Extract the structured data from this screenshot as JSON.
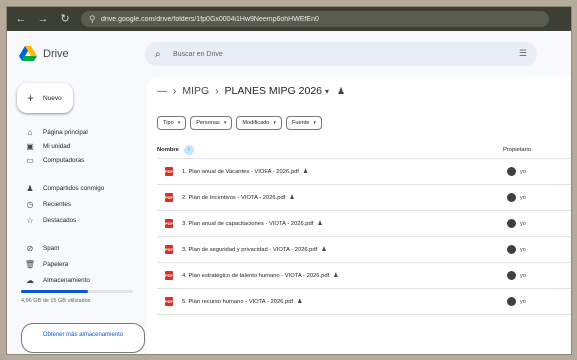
{
  "browser": {
    "url": "drive.google.com/drive/folders/1fp0Gx0004i1Hw9Neemp6ohHWEfEn0"
  },
  "app": {
    "name": "Drive",
    "search_placeholder": "Buscar en Drive"
  },
  "sidebar": {
    "new_label": "Nuevo",
    "items": [
      {
        "label": "Página principal",
        "icon": "home-icon"
      },
      {
        "label": "Mi unidad",
        "icon": "my-drive-icon"
      },
      {
        "label": "Computadoras",
        "icon": "computer-icon"
      },
      {
        "label": "Compartidos conmigo",
        "icon": "shared-icon"
      },
      {
        "label": "Recientes",
        "icon": "clock-icon"
      },
      {
        "label": "Destacados",
        "icon": "star-icon"
      },
      {
        "label": "Spam",
        "icon": "spam-icon"
      },
      {
        "label": "Papelera",
        "icon": "trash-icon"
      },
      {
        "label": "Almacenamiento",
        "icon": "cloud-icon"
      }
    ],
    "storage_used_fraction": 0.6,
    "storage_text": "4,96 GB de 15 GB utilizados",
    "get_more_label": "Obtener más almacenamiento"
  },
  "breadcrumb": {
    "parent": "MIPG",
    "current": "PLANES MIPG 2026"
  },
  "filters": [
    "Tipo",
    "Personas",
    "Modificado",
    "Fuente"
  ],
  "table": {
    "col_name": "Nombre",
    "col_owner": "Propietario",
    "rows": [
      {
        "name": "1. Plan anual de Vacantes - VIOFA - 2026.pdf",
        "owner": "yo"
      },
      {
        "name": "2. Plan de Incentivos - VIOTA - 2026.pdf",
        "owner": "yo"
      },
      {
        "name": "3. Plan anual de capacitaciones - VIOTA - 2026.pdf",
        "owner": "yo"
      },
      {
        "name": "3. Plan de seguridad y privacidad - VIOTA - 2026.pdf",
        "owner": "yo"
      },
      {
        "name": "4. Plan estratégico de talento humano - VIOTA - 2026.pdf",
        "owner": "yo"
      },
      {
        "name": "5. Plan recurso humano - VIOTA - 2026.pdf",
        "owner": "yo"
      }
    ]
  },
  "colors": {
    "accent": "#0b57d0",
    "pdf_red": "#d93025",
    "background": "#f7f9fc"
  }
}
